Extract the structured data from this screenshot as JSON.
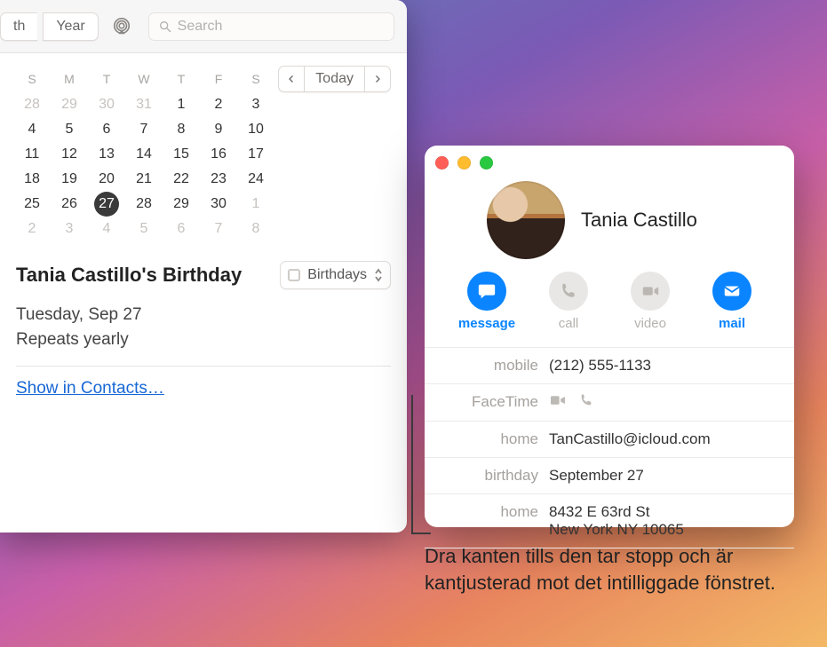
{
  "calendar": {
    "toolbar": {
      "view_month_partial": "th",
      "view_year": "Year",
      "search_placeholder": "Search"
    },
    "today_label": "Today",
    "dow": [
      "S",
      "M",
      "T",
      "W",
      "T",
      "F",
      "S"
    ],
    "weeks": [
      [
        {
          "n": 28,
          "dim": true
        },
        {
          "n": 29,
          "dim": true
        },
        {
          "n": 30,
          "dim": true
        },
        {
          "n": 31,
          "dim": true
        },
        {
          "n": 1
        },
        {
          "n": 2
        },
        {
          "n": 3
        }
      ],
      [
        {
          "n": 4
        },
        {
          "n": 5
        },
        {
          "n": 6
        },
        {
          "n": 7
        },
        {
          "n": 8
        },
        {
          "n": 9
        },
        {
          "n": 10
        }
      ],
      [
        {
          "n": 11
        },
        {
          "n": 12
        },
        {
          "n": 13
        },
        {
          "n": 14
        },
        {
          "n": 15
        },
        {
          "n": 16
        },
        {
          "n": 17
        }
      ],
      [
        {
          "n": 18
        },
        {
          "n": 19
        },
        {
          "n": 20
        },
        {
          "n": 21
        },
        {
          "n": 22
        },
        {
          "n": 23
        },
        {
          "n": 24
        }
      ],
      [
        {
          "n": 25
        },
        {
          "n": 26
        },
        {
          "n": 27,
          "today": true
        },
        {
          "n": 28
        },
        {
          "n": 29
        },
        {
          "n": 30
        },
        {
          "n": 1,
          "dim": true
        }
      ],
      [
        {
          "n": 2,
          "dim": true
        },
        {
          "n": 3,
          "dim": true
        },
        {
          "n": 4,
          "dim": true
        },
        {
          "n": 5,
          "dim": true
        },
        {
          "n": 6,
          "dim": true
        },
        {
          "n": 7,
          "dim": true
        },
        {
          "n": 8,
          "dim": true
        }
      ]
    ],
    "event": {
      "title": "Tania Castillo's Birthday",
      "calendar_tag": "Birthdays",
      "date": "Tuesday, Sep 27",
      "repeats": "Repeats yearly",
      "show_in_contacts": "Show in Contacts…"
    }
  },
  "contact": {
    "name": "Tania Castillo",
    "actions": {
      "message": "message",
      "call": "call",
      "video": "video",
      "mail": "mail"
    },
    "fields": {
      "mobile_label": "mobile",
      "mobile": "(212) 555-1133",
      "facetime_label": "FaceTime",
      "home_email_label": "home",
      "home_email": "TanCastillo@icloud.com",
      "birthday_label": "birthday",
      "birthday": "September 27",
      "home_addr_label": "home",
      "home_addr_line1": "8432 E 63rd St",
      "home_addr_line2": "New York NY 10065"
    }
  },
  "callout": "Dra kanten tills den tar stopp och är kantjusterad mot det intilliggade fönstret."
}
